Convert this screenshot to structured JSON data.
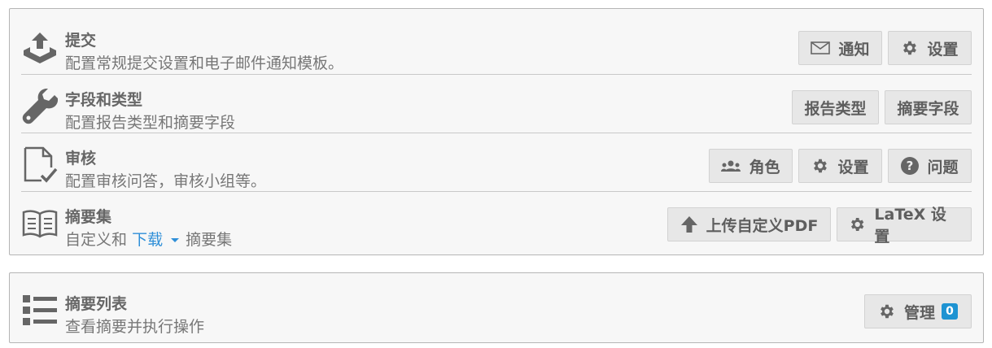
{
  "sections": [
    {
      "icon": "upload-tray-icon",
      "title": "提交",
      "desc": "配置常规提交设置和电子邮件通知模板。",
      "actions": [
        "通知",
        "设置"
      ]
    },
    {
      "icon": "wrench-icon",
      "title": "字段和类型",
      "desc": "配置报告类型和摘要字段",
      "actions": [
        "报告类型",
        "摘要字段"
      ]
    },
    {
      "icon": "document-check-icon",
      "title": "审核",
      "desc": "配置审核问答，审核小组等。",
      "actions": [
        "角色",
        "设置",
        "问题"
      ]
    },
    {
      "icon": "open-book-icon",
      "title": "摘要集",
      "desc_prefix": "自定义和",
      "desc_link": "下载",
      "desc_suffix": "摘要集",
      "actions": [
        "上传自定义PDF",
        "LaTeX 设置"
      ]
    }
  ],
  "list_section": {
    "icon": "list-icon",
    "title": "摘要列表",
    "desc": "查看摘要并执行操作",
    "manage_label": "管理",
    "manage_count": "0"
  },
  "colors": {
    "accent": "#1d93d2",
    "link": "#2f8fd8",
    "panel_bg": "#f7f7f7"
  }
}
